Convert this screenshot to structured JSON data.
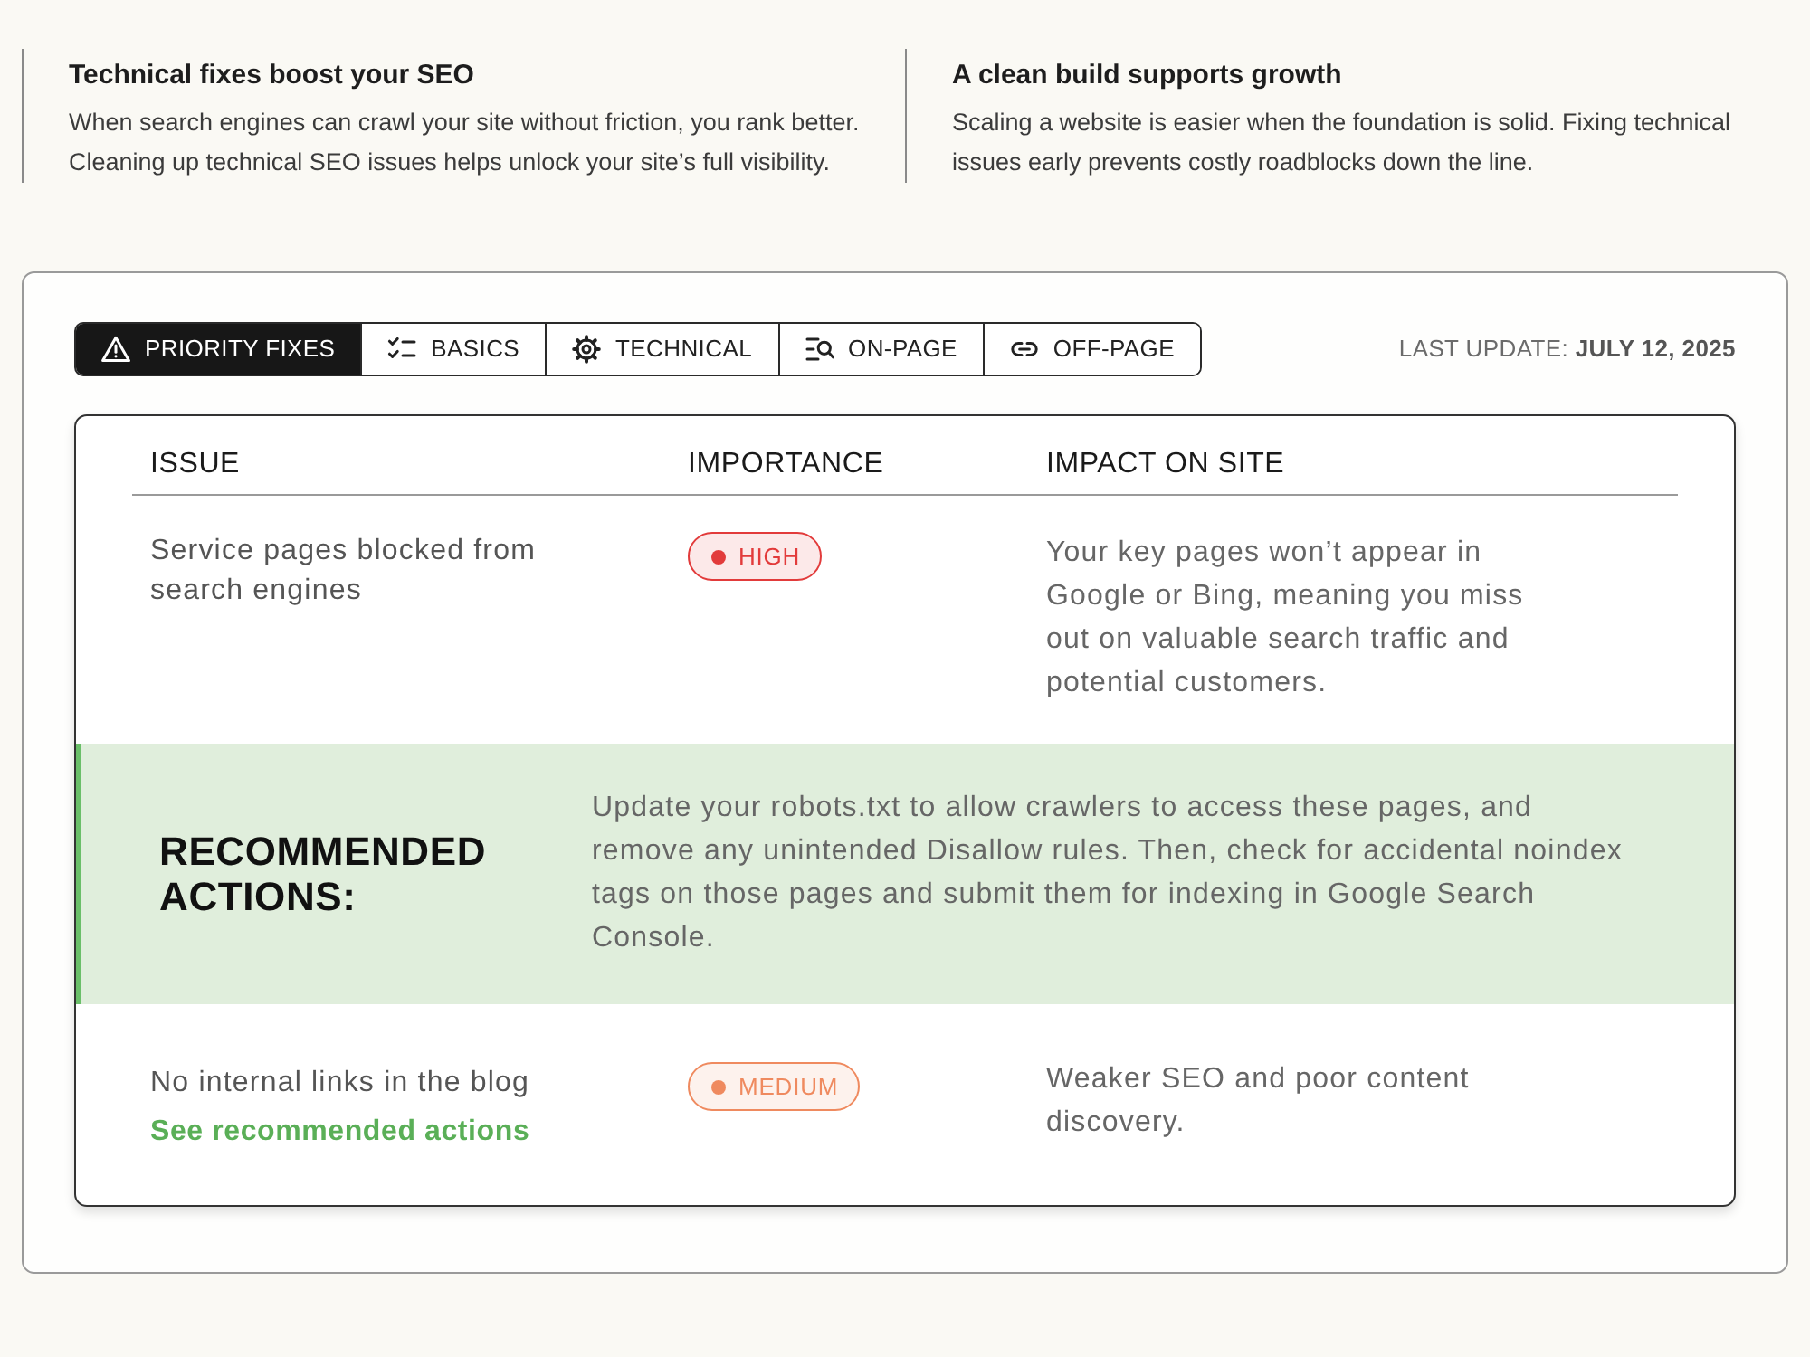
{
  "features": [
    {
      "title": "Technical fixes boost your SEO",
      "text": "When search engines can crawl your site without friction, you rank better. Cleaning up technical SEO issues helps unlock your site’s full visibility."
    },
    {
      "title": "A clean build supports growth",
      "text": "Scaling a website is easier when the foundation is solid. Fixing technical issues early prevents costly roadblocks down the line."
    }
  ],
  "tabs": [
    {
      "label": "PRIORITY FIXES",
      "selected": true
    },
    {
      "label": "BASICS",
      "selected": false
    },
    {
      "label": "TECHNICAL",
      "selected": false
    },
    {
      "label": "ON-PAGE",
      "selected": false
    },
    {
      "label": "OFF-PAGE",
      "selected": false
    }
  ],
  "last_update": {
    "label": "LAST UPDATE:",
    "date": "JULY 12, 2025"
  },
  "table": {
    "columns": [
      "ISSUE",
      "IMPORTANCE",
      "IMPACT ON SITE"
    ],
    "rows": [
      {
        "issue": "Service pages blocked from search engines",
        "importance": {
          "label": "HIGH",
          "color": "#e23b3b"
        },
        "impact": "Your key pages won’t appear in Google or Bing, meaning you miss out on valuable search traffic and potential customers.",
        "expanded": true,
        "recommended_actions": {
          "heading": "RECOMMENDED ACTIONS:",
          "text": "Update your robots.txt to allow crawlers to access these pages, and remove any unintended Disallow rules. Then, check for accidental noindex tags on those pages and submit them for indexing in Google Search Console."
        }
      },
      {
        "issue": "No internal links in the blog",
        "importance": {
          "label": "MEDIUM",
          "color": "#ef8a5f"
        },
        "impact": "Weaker SEO and poor content discovery.",
        "expanded": false,
        "actions_link": "See recommended actions"
      }
    ]
  }
}
